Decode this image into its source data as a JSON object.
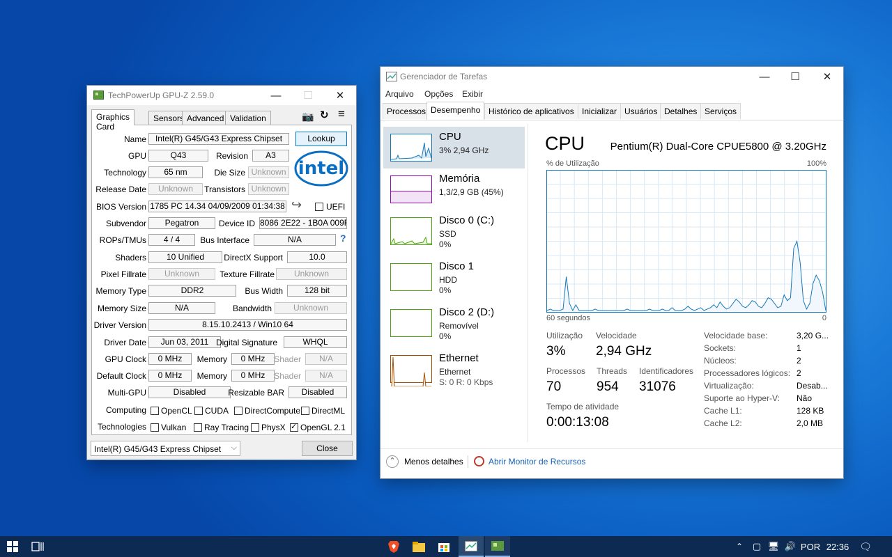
{
  "gpuz": {
    "title": "TechPowerUp GPU-Z 2.59.0",
    "tabs": [
      "Graphics Card",
      "Sensors",
      "Advanced",
      "Validation"
    ],
    "fields": {
      "name_lbl": "Name",
      "name": "Intel(R) G45/G43 Express Chipset",
      "gpu_lbl": "GPU",
      "gpu": "Q43",
      "revision_lbl": "Revision",
      "revision": "A3",
      "technology_lbl": "Technology",
      "technology": "65 nm",
      "die_size_lbl": "Die Size",
      "die_size": "Unknown",
      "release_date_lbl": "Release Date",
      "release_date": "Unknown",
      "transistors_lbl": "Transistors",
      "transistors": "Unknown",
      "bios_lbl": "BIOS Version",
      "bios": "1785 PC 14.34 04/09/2009 01:34:38",
      "uefi_lbl": "UEFI",
      "subvendor_lbl": "Subvendor",
      "subvendor": "Pegatron",
      "device_id_lbl": "Device ID",
      "device_id": "8086 2E22 - 1B0A 009F",
      "rops_lbl": "ROPs/TMUs",
      "rops": "4 / 4",
      "bus_iface_lbl": "Bus Interface",
      "bus_iface": "N/A",
      "shaders_lbl": "Shaders",
      "shaders": "10 Unified",
      "directx_lbl": "DirectX Support",
      "directx": "10.0",
      "pixel_lbl": "Pixel Fillrate",
      "pixel": "Unknown",
      "texture_lbl": "Texture Fillrate",
      "texture": "Unknown",
      "memtype_lbl": "Memory Type",
      "memtype": "DDR2",
      "buswidth_lbl": "Bus Width",
      "buswidth": "128 bit",
      "memsize_lbl": "Memory Size",
      "memsize": "N/A",
      "bandwidth_lbl": "Bandwidth",
      "bandwidth": "Unknown",
      "driver_ver_lbl": "Driver Version",
      "driver_ver": "8.15.10.2413 / Win10 64",
      "driver_date_lbl": "Driver Date",
      "driver_date": "Jun 03, 2011",
      "digsig_lbl": "Digital Signature",
      "digsig": "WHQL",
      "gpuclock_lbl": "GPU Clock",
      "gpuclock": "0 MHz",
      "memory_lbl": "Memory",
      "gpuclock_mem": "0 MHz",
      "shader_lbl": "Shader",
      "gpuclock_shader": "N/A",
      "defclock_lbl": "Default Clock",
      "defclock": "0 MHz",
      "defclock_mem": "0 MHz",
      "defclock_shader": "N/A",
      "multigpu_lbl": "Multi-GPU",
      "multigpu": "Disabled",
      "rebar_lbl": "Resizable BAR",
      "rebar": "Disabled",
      "computing_lbl": "Computing",
      "technologies_lbl": "Technologies"
    },
    "computing": [
      "OpenCL",
      "CUDA",
      "DirectCompute",
      "DirectML"
    ],
    "technologies": [
      "Vulkan",
      "Ray Tracing",
      "PhysX",
      "OpenGL 2.1"
    ],
    "lookup_label": "Lookup",
    "logo_text": "intel",
    "question": "?",
    "select_value": "Intel(R) G45/G43 Express Chipset",
    "close_label": "Close"
  },
  "tm": {
    "title": "Gerenciador de Tarefas",
    "menu": [
      "Arquivo",
      "Opções",
      "Exibir"
    ],
    "tabs": [
      "Processos",
      "Desempenho",
      "Histórico de aplicativos",
      "Inicializar",
      "Usuários",
      "Detalhes",
      "Serviços"
    ],
    "side": [
      {
        "name": "CPU",
        "sub1": "3% 2,94 GHz",
        "sub2": ""
      },
      {
        "name": "Memória",
        "sub1": "1,3/2,9 GB (45%)",
        "sub2": ""
      },
      {
        "name": "Disco 0 (C:)",
        "sub1": "SSD",
        "sub2": "0%"
      },
      {
        "name": "Disco 1",
        "sub1": "HDD",
        "sub2": "0%"
      },
      {
        "name": "Disco 2 (D:)",
        "sub1": "Removível",
        "sub2": "0%"
      },
      {
        "name": "Ethernet",
        "sub1": "Ethernet",
        "sub2": "S: 0 R: 0 Kbps"
      }
    ],
    "cpu_title": "CPU",
    "cpu_model": "Pentium(R) Dual-Core CPUE5800 @ 3.20GHz",
    "graph_ylabel": "% de Utilização",
    "graph_ymax": "100%",
    "graph_xlabel": "60 segundos",
    "graph_xmin": "0",
    "stats": {
      "util_lbl": "Utilização",
      "util": "3%",
      "speed_lbl": "Velocidade",
      "speed": "2,94 GHz",
      "proc_lbl": "Processos",
      "proc": "70",
      "threads_lbl": "Threads",
      "threads": "954",
      "handles_lbl": "Identificadores",
      "handles": "31076",
      "uptime_lbl": "Tempo de atividade",
      "uptime": "0:00:13:08"
    },
    "right": [
      [
        "Velocidade base:",
        "3,20 G..."
      ],
      [
        "Sockets:",
        "1"
      ],
      [
        "Núcleos:",
        "2"
      ],
      [
        "Processadores lógicos:",
        "2"
      ],
      [
        "Virtualização:",
        "Desab..."
      ],
      [
        "Suporte ao Hyper-V:",
        "Não"
      ],
      [
        "Cache L1:",
        "128 KB"
      ],
      [
        "Cache L2:",
        "2,0 MB"
      ]
    ],
    "fewer_details": "Menos detalhes",
    "resource_monitor": "Abrir Monitor de Recursos",
    "cpu_series": [
      1,
      2,
      1,
      1,
      1,
      2,
      25,
      6,
      1,
      5,
      1,
      1,
      1,
      1,
      1,
      2,
      1,
      1,
      1,
      1,
      1,
      1,
      1,
      1,
      1,
      2,
      1,
      1,
      1,
      1,
      1,
      1,
      2,
      1,
      1,
      1,
      2,
      1,
      1,
      3,
      1,
      1,
      1,
      2,
      4,
      2,
      1,
      2,
      3,
      1,
      2,
      3,
      5,
      3,
      7,
      4,
      2,
      3,
      6,
      9,
      7,
      4,
      3,
      5,
      8,
      7,
      4,
      3,
      6,
      10,
      9,
      6,
      3,
      4,
      12,
      8,
      10,
      45,
      50,
      35,
      8,
      2,
      6,
      20,
      26,
      22,
      14,
      1
    ]
  },
  "taskbar": {
    "lang": "POR",
    "time": "22:36"
  }
}
